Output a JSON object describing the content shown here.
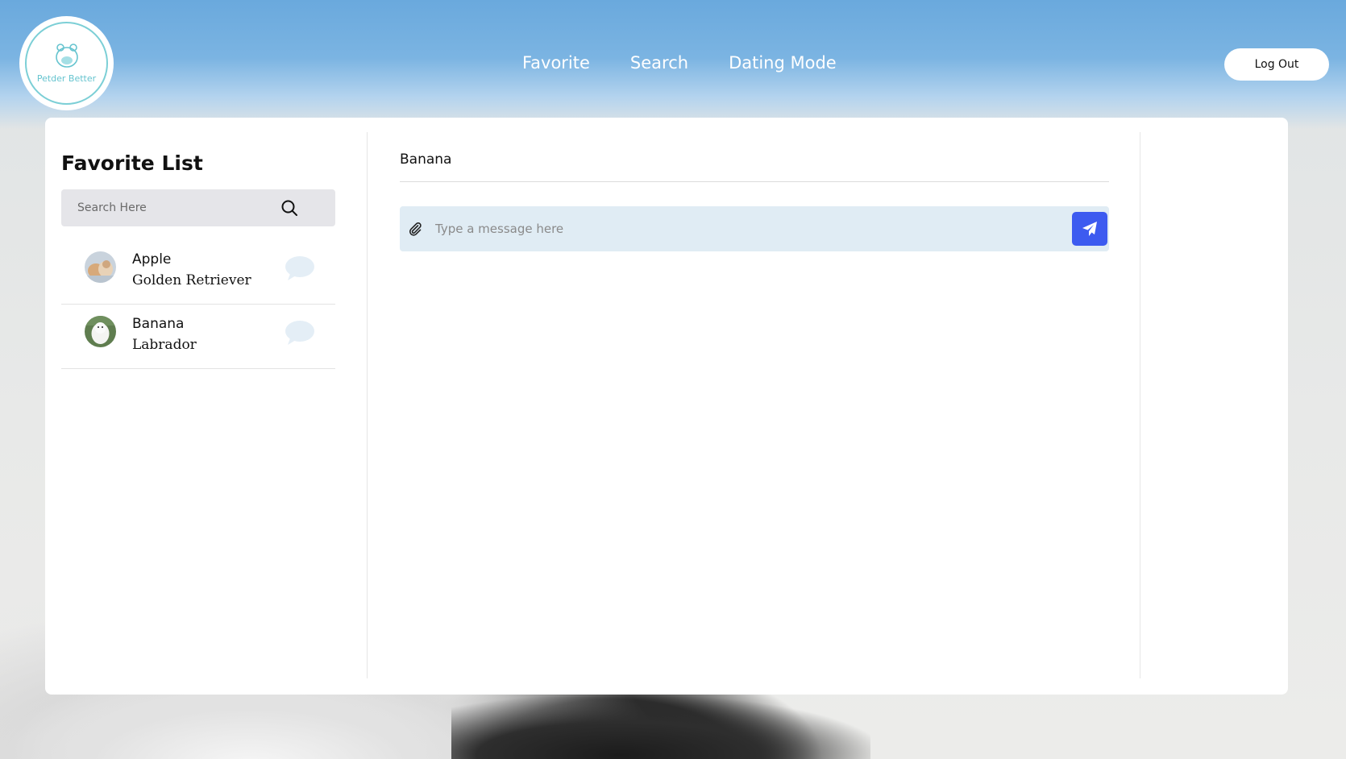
{
  "brand": {
    "logo_text": "Petder Better",
    "logo_icon": "hamster-icon"
  },
  "nav": {
    "items": [
      {
        "label": "Favorite"
      },
      {
        "label": "Search"
      },
      {
        "label": "Dating Mode"
      }
    ]
  },
  "header": {
    "logout_label": "Log Out"
  },
  "favorites": {
    "title": "Favorite List",
    "search_placeholder": "Search Here",
    "items": [
      {
        "name": "Apple",
        "breed": "Golden Retriever",
        "icon": "chat-bubble-icon"
      },
      {
        "name": "Banana",
        "breed": "Labrador",
        "icon": "chat-bubble-icon"
      }
    ]
  },
  "chat": {
    "recipient": "Banana",
    "message_placeholder": "Type a message here",
    "send_icon": "paper-plane-icon",
    "attach_icon": "paperclip-icon"
  },
  "colors": {
    "header": "#6aa9dd",
    "send_button": "#3d5bf0",
    "message_bar": "#e0ecf4",
    "logo_accent": "#7ccfd6"
  }
}
